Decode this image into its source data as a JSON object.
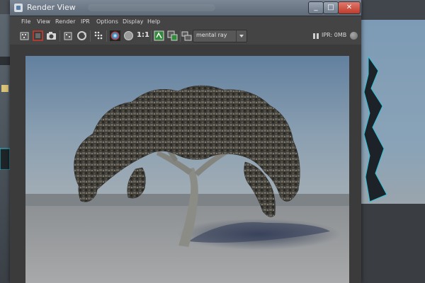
{
  "window": {
    "title": "Render View",
    "controls": {
      "minimize": "_",
      "maximize": "□",
      "close": "✕"
    }
  },
  "menu": [
    "File",
    "View",
    "Render",
    "IPR",
    "Options",
    "Display",
    "Help"
  ],
  "toolbar": {
    "one_to_one": "1:1",
    "renderer": "mental ray",
    "ipr_status": "IPR: 0MB"
  },
  "render": {
    "subject": "tree"
  },
  "colors": {
    "titlebar": "#6b7785",
    "close": "#c94a3b",
    "panel": "#444444"
  }
}
